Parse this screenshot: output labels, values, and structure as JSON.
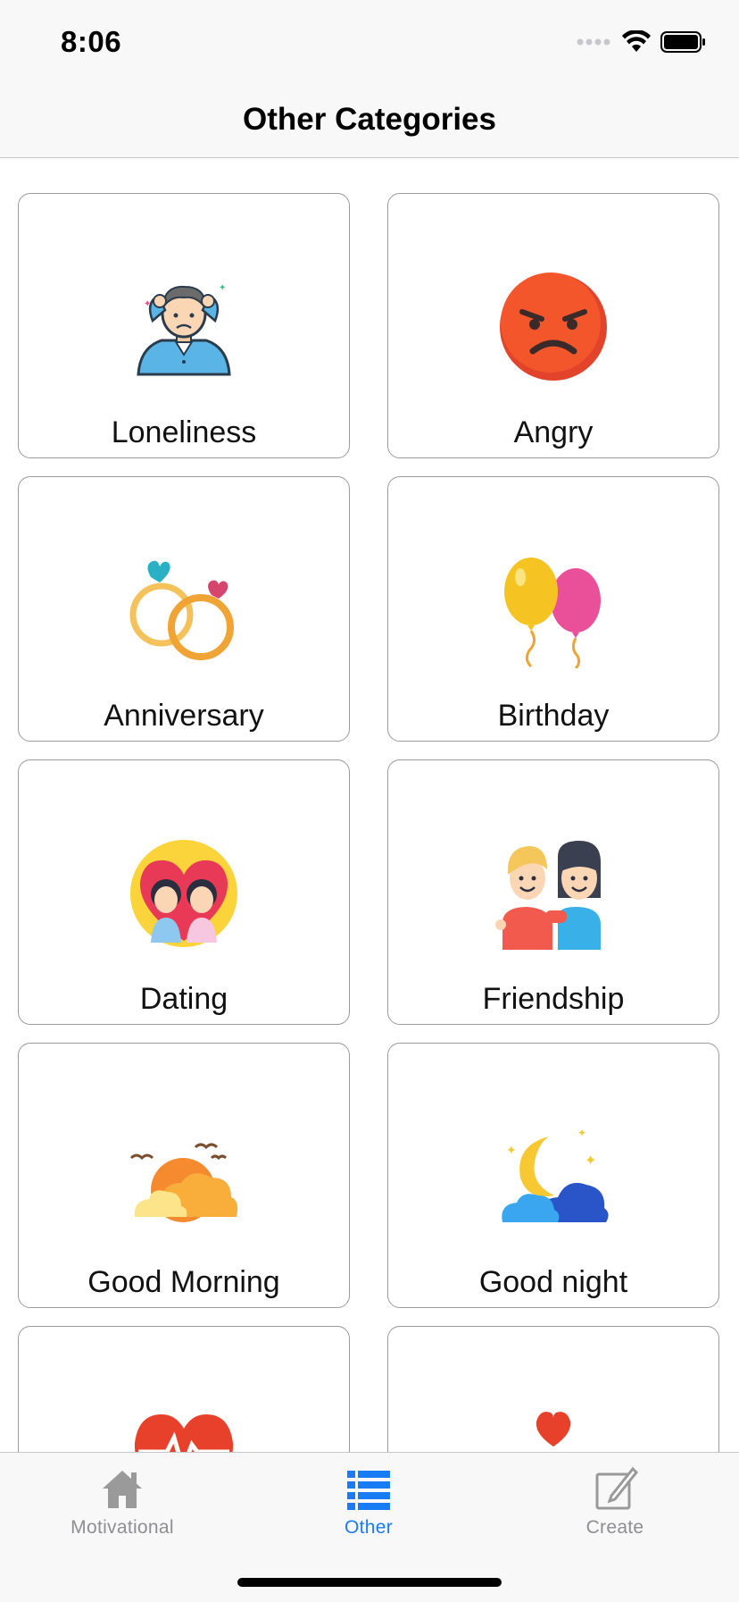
{
  "status_bar": {
    "time": "8:06"
  },
  "nav": {
    "title": "Other Categories"
  },
  "categories": [
    {
      "label": "Loneliness",
      "icon": "stressed-man-icon"
    },
    {
      "label": "Angry",
      "icon": "angry-face-icon"
    },
    {
      "label": "Anniversary",
      "icon": "wedding-rings-icon"
    },
    {
      "label": "Birthday",
      "icon": "balloons-icon"
    },
    {
      "label": "Dating",
      "icon": "couple-heart-icon"
    },
    {
      "label": "Friendship",
      "icon": "friends-icon"
    },
    {
      "label": "Good Morning",
      "icon": "sunrise-icon"
    },
    {
      "label": "Good night",
      "icon": "moon-cloud-icon"
    },
    {
      "label": "",
      "icon": "heartbeat-icon"
    },
    {
      "label": "",
      "icon": "love-couple-icon"
    }
  ],
  "tabs": [
    {
      "label": "Motivational",
      "icon": "home-icon",
      "active": false
    },
    {
      "label": "Other",
      "icon": "list-icon",
      "active": true
    },
    {
      "label": "Create",
      "icon": "compose-icon",
      "active": false
    }
  ],
  "colors": {
    "accent": "#1a7cf5",
    "inactive": "#8e8e93"
  }
}
